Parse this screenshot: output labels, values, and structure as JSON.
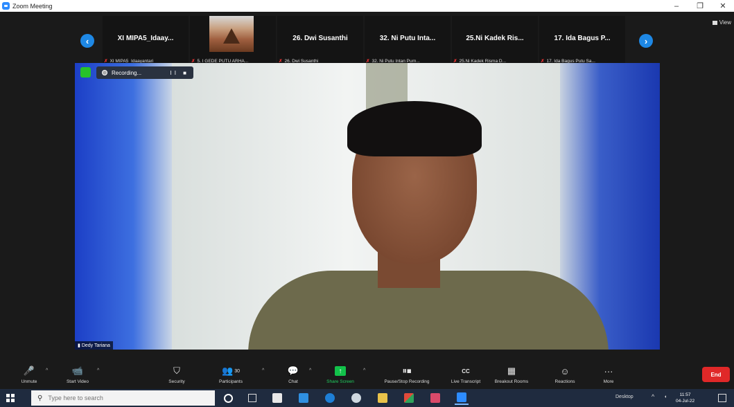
{
  "window": {
    "title": "Zoom Meeting",
    "controls": [
      "–",
      "❐",
      "✕"
    ]
  },
  "view_button": {
    "label": "View"
  },
  "gallery": {
    "tiles": [
      {
        "name": "XI MIPA5_Idaay...",
        "caption": "XI MIPA5_Idaayantari",
        "has_thumbnail": false
      },
      {
        "name": "",
        "caption": "5. I GEDE PUTU ARHA...",
        "has_thumbnail": true
      },
      {
        "name": "26. Dwi Susanthi",
        "caption": "26. Dwi Susanthi",
        "has_thumbnail": false
      },
      {
        "name": "32. Ni Putu Inta...",
        "caption": "32. Ni Putu Intan Purn...",
        "has_thumbnail": false
      },
      {
        "name": "25.Ni Kadek Ris...",
        "caption": "25.Ni Kadek Risma D...",
        "has_thumbnail": false
      },
      {
        "name": "17. Ida Bagus P...",
        "caption": "17. Ida Bagus Putu Sa...",
        "has_thumbnail": false
      }
    ]
  },
  "main_video": {
    "speaker_name": "Dedy Tariana",
    "recording_label": "Recording...",
    "recording_controls": "II ■"
  },
  "toolbar": {
    "items": [
      {
        "key": "unmute",
        "label": "Unmute",
        "icon": "mic-muted-icon",
        "glyph": "🎤"
      },
      {
        "key": "start-video",
        "label": "Start Video",
        "icon": "video-off-icon",
        "glyph": "📹"
      },
      {
        "key": "security",
        "label": "Security",
        "icon": "shield-icon",
        "glyph": "⛉"
      },
      {
        "key": "participants",
        "label": "Participants",
        "icon": "participants-icon",
        "glyph": "👥",
        "count": "30"
      },
      {
        "key": "chat",
        "label": "Chat",
        "icon": "chat-icon",
        "glyph": "💬"
      },
      {
        "key": "share-screen",
        "label": "Share Screen",
        "icon": "share-screen-icon",
        "glyph": "↑"
      },
      {
        "key": "pause-stop-recording",
        "label": "Pause/Stop Recording",
        "icon": "pause-stop-icon",
        "glyph": "⏸⏹"
      },
      {
        "key": "live-transcript",
        "label": "Live Transcript",
        "icon": "cc-icon",
        "glyph": "CC"
      },
      {
        "key": "breakout-rooms",
        "label": "Breakout Rooms",
        "icon": "breakout-rooms-icon",
        "glyph": "▦"
      },
      {
        "key": "reactions",
        "label": "Reactions",
        "icon": "reactions-icon",
        "glyph": "☺"
      },
      {
        "key": "more",
        "label": "More",
        "icon": "more-icon",
        "glyph": "···"
      }
    ],
    "end_label": "End"
  },
  "taskbar": {
    "search_placeholder": "Type here to search",
    "desktop_label": "Desktop",
    "time": "11:57",
    "date": "04-Jul-22"
  },
  "colors": {
    "accent": "#2d8cff",
    "share": "#12c24a",
    "end": "#e02828",
    "taskbar": "#1f2b3f"
  }
}
